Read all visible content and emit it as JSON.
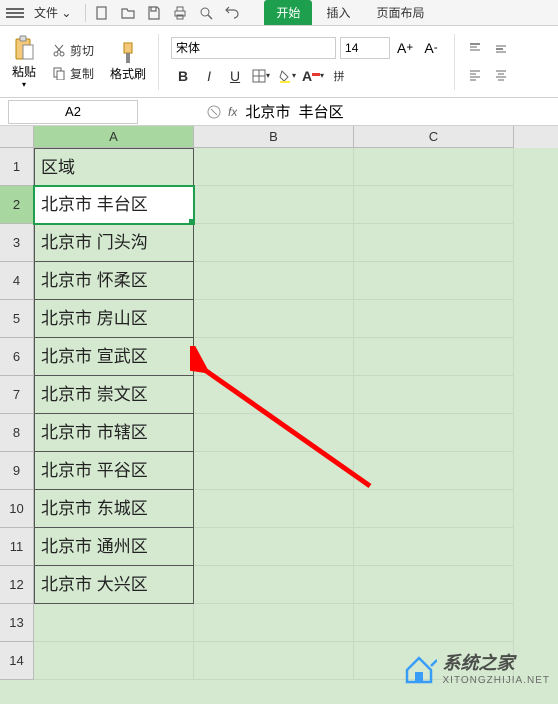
{
  "menu": {
    "file_label": "文件",
    "tabs": {
      "start": "开始",
      "insert": "插入",
      "page_layout": "页面布局"
    }
  },
  "ribbon": {
    "paste": "粘贴",
    "cut": "剪切",
    "copy": "复制",
    "format_painter": "格式刷",
    "font_name": "宋体",
    "font_size": "14",
    "bold": "B",
    "italic": "I",
    "underline": "U"
  },
  "formula_bar": {
    "name_box": "A2",
    "fx": "fx",
    "value": "北京市  丰台区"
  },
  "columns": [
    "A",
    "B",
    "C"
  ],
  "rows_count": 14,
  "active_cell": {
    "row": 2,
    "col": "A"
  },
  "cells": {
    "A1": "区域",
    "A2": "北京市  丰台区",
    "A3": "北京市  门头沟",
    "A4": "北京市  怀柔区",
    "A5": "北京市  房山区",
    "A6": "北京市  宣武区",
    "A7": "北京市  崇文区",
    "A8": "北京市  市辖区",
    "A9": "北京市  平谷区",
    "A10": "北京市  东城区",
    "A11": "北京市  通州区",
    "A12": "北京市  大兴区"
  },
  "watermark": {
    "title": "系统之家",
    "url": "XITONGZHIJIA.NET"
  }
}
